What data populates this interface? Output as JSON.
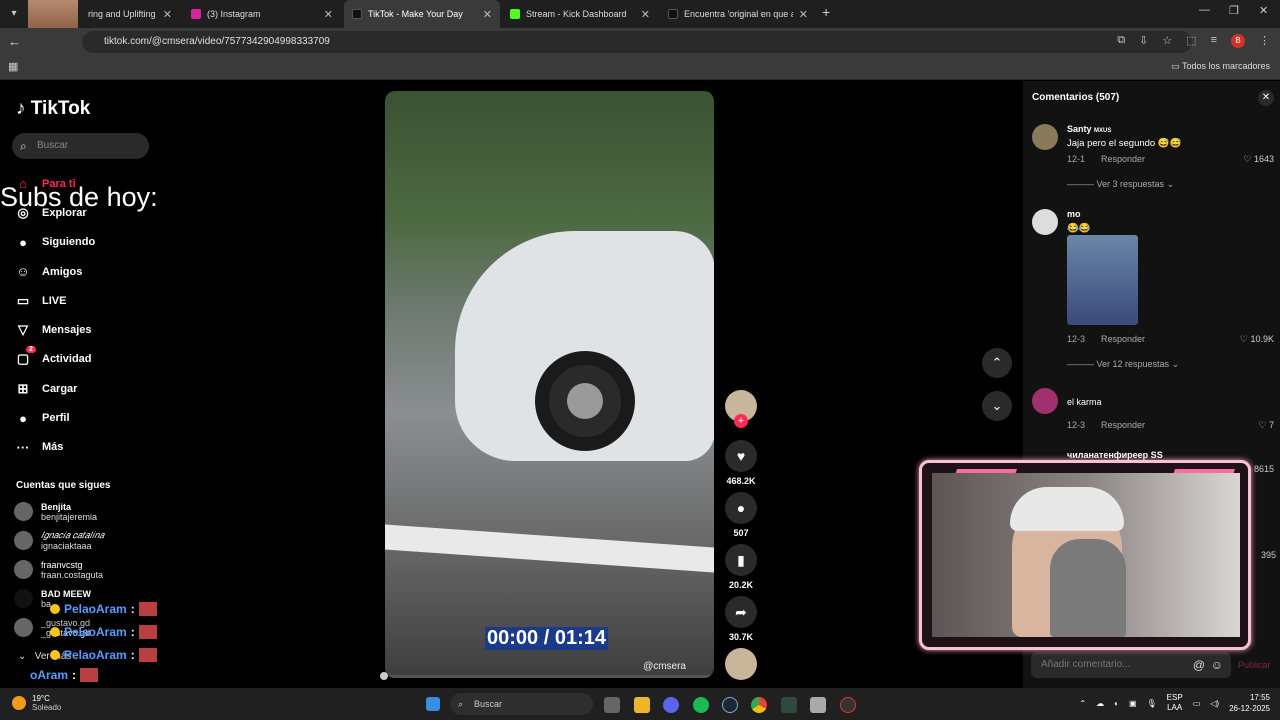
{
  "browser": {
    "tabs": [
      {
        "title": "ring and Uplifting Backg",
        "color": "#e33"
      },
      {
        "title": "(3) Instagram",
        "color": "#d6249f"
      },
      {
        "title": "TikTok - Make Your Day",
        "color": "#000"
      },
      {
        "title": "Stream - Kick Dashboard",
        "color": "#53fc18"
      },
      {
        "title": "Encuentra 'original en que aspe",
        "color": "#000"
      }
    ],
    "url": "tiktok.com/@cmsera/video/7577342904998333709",
    "profile_initial": "B",
    "bookmarks_all": "Todos los marcadores"
  },
  "tiktok": {
    "logo": "TikTok",
    "search_placeholder": "Buscar",
    "nav": [
      {
        "label": "Para ti",
        "icon": "home-icon",
        "glyph": "⌂",
        "active": true
      },
      {
        "label": "Explorar",
        "icon": "compass-icon",
        "glyph": "◎"
      },
      {
        "label": "Siguiendo",
        "icon": "following-avatar-icon",
        "glyph": "●"
      },
      {
        "label": "Amigos",
        "icon": "friends-icon",
        "glyph": "☺"
      },
      {
        "label": "LIVE",
        "icon": "live-icon",
        "glyph": "▭"
      },
      {
        "label": "Mensajes",
        "icon": "messages-icon",
        "glyph": "▽"
      },
      {
        "label": "Actividad",
        "icon": "activity-icon",
        "glyph": "▢"
      },
      {
        "label": "Cargar",
        "icon": "upload-icon",
        "glyph": "⊞"
      },
      {
        "label": "Perfil",
        "icon": "profile-icon",
        "glyph": "●"
      },
      {
        "label": "Más",
        "icon": "more-icon",
        "glyph": "···"
      }
    ],
    "activity_badge": "2",
    "following_title": "Cuentas que sigues",
    "following": [
      {
        "name": "Benjita",
        "handle": "benjitajeremia"
      },
      {
        "name": "𝐼𝑔𝑛𝑎𝑐𝑖𝑎 𝑐𝑎𝑡𝑎𝑙𝑖𝑛𝑎",
        "handle": "ignaciaktaaa"
      },
      {
        "name": "fraanvcstg",
        "handle": "fraan.costaguta"
      },
      {
        "name": "BAD MEEW",
        "handle": "ba"
      },
      {
        "name": "_gustavo.gd",
        "handle": "_gustavo.gd"
      }
    ],
    "ver_mas": "Ver más"
  },
  "overlay": {
    "subs_text": "Subs de hoy:",
    "chat_user": "PelaoAram",
    "chat_colon": ":",
    "chat_last_user": "oAram"
  },
  "video": {
    "timecode": "00:00 / 01:14",
    "handle": "@cmsera",
    "likes": "468.2K",
    "comments": "507",
    "saves": "20.2K",
    "shares": "30.7K"
  },
  "comments": {
    "title": "Comentarios (507)",
    "reply_label": "Responder",
    "items": [
      {
        "user": "Santy",
        "tag": "MXUS",
        "text": "Jaja pero el segundo 😅😅",
        "date": "12-1",
        "likes": "1643",
        "replies": "Ver 3 respuestas"
      },
      {
        "user": "mo",
        "text": "😂😂",
        "date": "12-3",
        "likes": "10.9K",
        "replies": "Ver 12 respuestas"
      },
      {
        "user": "el karma",
        "text": "",
        "date": "12-3",
        "likes": "7"
      },
      {
        "user": "чиланатенфиреер SS",
        "likes": "8615"
      }
    ],
    "side_count": "395",
    "input_placeholder": "Añadir comentario...",
    "publish": "Publicar"
  },
  "taskbar": {
    "temp": "19°C",
    "condition": "Soleado",
    "search": "Buscar",
    "lang1": "ESP",
    "lang2": "LAA",
    "time": "17:55",
    "date": "26-12-2025"
  }
}
